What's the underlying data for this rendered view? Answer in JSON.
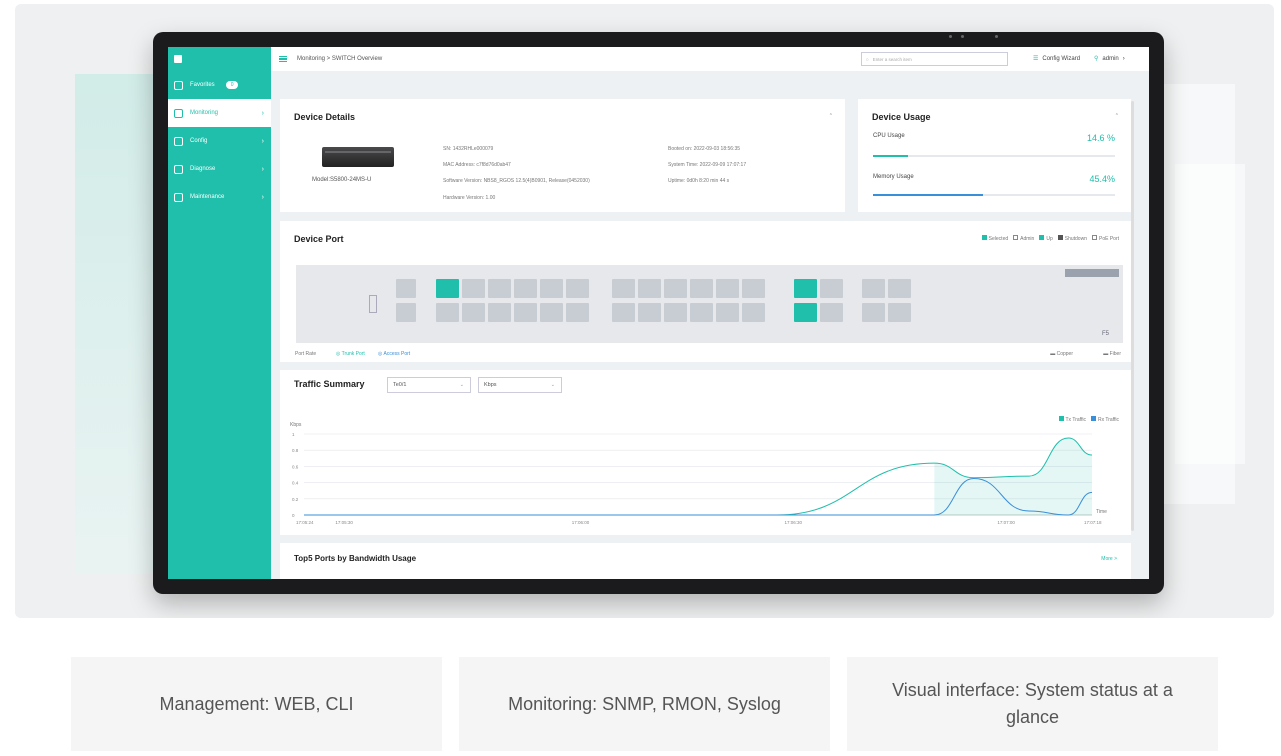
{
  "sidebar": {
    "items": [
      {
        "label": "Favorites",
        "badge": "0"
      },
      {
        "label": "Monitoring"
      },
      {
        "label": "Config"
      },
      {
        "label": "Diagnose"
      },
      {
        "label": "Maintenance"
      }
    ]
  },
  "topbar": {
    "breadcrumb": "Monitoring > SWITCH Overview",
    "search_placeholder": "Enter a search item",
    "config_wizard": "Config Wizard",
    "user": "admin"
  },
  "device_details": {
    "title": "Device Details",
    "model": "Model:S5800-24MS-U",
    "sn": "SN: 1432RHLe000079",
    "mac": "MAC Address: c7f8d76d0ab47",
    "software": "Software Version: NBS8_RGOS 12.5(4)B0901, Release(0452030)",
    "hardware": "Hardware Version: 1.00",
    "booted": "Booted on: 2022-09-03 18:56:35",
    "system_time": "System Time: 2022-09-09 17:07:17",
    "uptime": "Uptime: 0d0h 8:20 min 44 s"
  },
  "device_usage": {
    "title": "Device Usage",
    "cpu_label": "CPU Usage",
    "cpu_value": "14.6 %",
    "cpu_fraction": 0.146,
    "mem_label": "Memory Usage",
    "mem_value": "45.4%",
    "mem_fraction": 0.454
  },
  "device_port": {
    "title": "Device Port",
    "legend": [
      "Selected",
      "Admin",
      "Up",
      "Shutdown",
      "PoE Port"
    ],
    "port_rate": "Port Rate",
    "trunk_port": "Trunk Port",
    "access_port": "Access Port",
    "copper": "Copper",
    "fiber": "Fiber",
    "fiber_port_count": "F5"
  },
  "traffic_summary": {
    "title": "Traffic Summary",
    "port_select": "Te0/1",
    "unit_select": "Kbps",
    "legend_tx": "Tx Traffic",
    "legend_rx": "Rx Traffic",
    "y_unit": "Kbps",
    "time_label": "Time"
  },
  "top5": {
    "title": "Top5 Ports by Bandwidth Usage",
    "more": "More >"
  },
  "features": [
    "Management: WEB, CLI",
    "Monitoring: SNMP, RMON, Syslog",
    "Visual interface: System status at a glance"
  ],
  "colors": {
    "accent": "#1fbfab",
    "rx": "#3a8fd9"
  },
  "chart_data": {
    "type": "line",
    "x": [
      "17:05:24",
      "17:05:30",
      "17:06:00",
      "17:06:30",
      "17:07:00",
      "17:07:18"
    ],
    "yticks": [
      "0",
      "0.2",
      "0.4",
      "0.6",
      "0.8",
      "1"
    ],
    "ylim": [
      0,
      1
    ],
    "ylabel": "Kbps",
    "xlabel": "Time",
    "series": [
      {
        "name": "Tx Traffic",
        "color": "#1fbfab",
        "values": [
          0,
          0,
          0,
          0.64,
          0.46,
          0.48,
          0.95,
          0.74
        ]
      },
      {
        "name": "Rx Traffic",
        "color": "#3a8fd9",
        "values": [
          0,
          0,
          0,
          0,
          0.45,
          0.05,
          0,
          0.28
        ]
      }
    ],
    "x_points": [
      0,
      0.3,
      0.6,
      0.8,
      0.85,
      0.92,
      0.97,
      1.0
    ]
  }
}
